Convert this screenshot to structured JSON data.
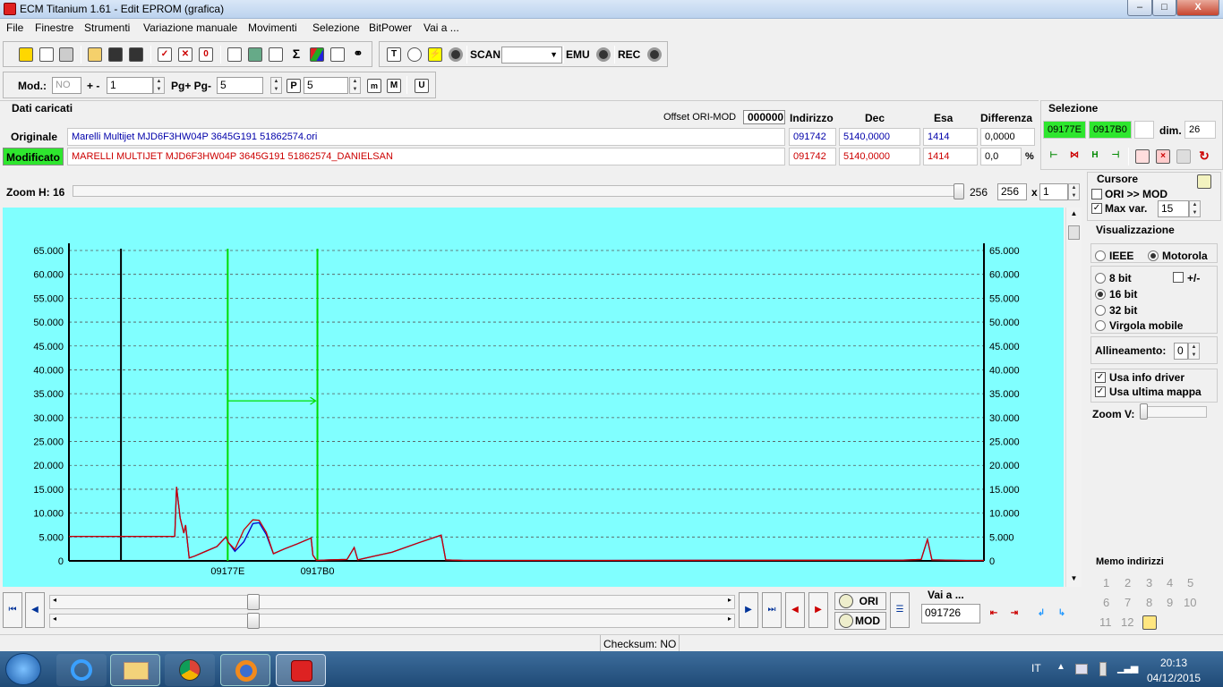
{
  "window": {
    "title": "ECM Titanium 1.61 - Edit EPROM (grafica)",
    "min": "–",
    "max": "□",
    "close": "X"
  },
  "menu": [
    "File",
    "Finestre",
    "Strumenti",
    "Variazione manuale",
    "Movimenti",
    "Selezione",
    "BitPower",
    "Vai a ..."
  ],
  "toolbar": {
    "scan": "SCAN",
    "emu": "EMU",
    "rec": "REC"
  },
  "toolbar2": {
    "mod_label": "Mod.:",
    "mod_value": "NO",
    "plusminus_label": "+ -",
    "plusminus_value": "1",
    "pg_label": "Pg+ Pg-",
    "pg_value": "5",
    "p_icon": "P",
    "p_value": "5",
    "m1": "m",
    "m2": "M",
    "u": "U"
  },
  "loaded": {
    "title": "Dati caricati",
    "offset_label": "Offset ORI-MOD",
    "offset_value": "000000",
    "col_indirizzo": "Indirizzo",
    "col_dec": "Dec",
    "col_esa": "Esa",
    "col_diff": "Differenza",
    "originale": {
      "label": "Originale",
      "file": "Marelli Multijet MJD6F3HW04P 3645G191 51862574.ori",
      "indirizzo": "091742",
      "dec": "5140,0000",
      "esa": "1414",
      "diff": "0,0000"
    },
    "modificato": {
      "label": "Modificato",
      "file": "MARELLI MULTIJET MJD6F3HW04P 3645G191 51862574_DANIELSAN",
      "indirizzo": "091742",
      "dec": "5140,0000",
      "esa": "1414",
      "diff": "0,0",
      "pct": "%"
    }
  },
  "selezione": {
    "title": "Selezione",
    "start": "09177E",
    "end": "0917B0",
    "dim_label": "dim.",
    "dim_value": "26"
  },
  "zoom": {
    "label": "Zoom H: 16",
    "value1": "256",
    "value2": "256",
    "x": "x",
    "value3": "1"
  },
  "cursore": {
    "title": "Cursore",
    "ori_mod": "ORI >> MOD",
    "max_var": "Max var.",
    "max_var_value": "15"
  },
  "visualizzazione": {
    "title": "Visualizzazione",
    "ieee": "IEEE",
    "motorola": "Motorola",
    "b8": "8 bit",
    "pm": "+/-",
    "b16": "16 bit",
    "b32": "32 bit",
    "virgola": "Virgola mobile",
    "allineamento": "Allineamento:",
    "allineamento_value": "0",
    "usa_info": "Usa info driver",
    "usa_ultima": "Usa ultima mappa",
    "zoom_v": "Zoom V:"
  },
  "memo": {
    "title": "Memo indirizzi",
    "numbers": [
      "1",
      "2",
      "3",
      "4",
      "5",
      "6",
      "7",
      "8",
      "9",
      "10",
      "11",
      "12"
    ]
  },
  "bottom": {
    "ori": "ORI",
    "mod": "MOD",
    "vai_label": "Vai a ...",
    "vai_value": "091726",
    "checksum": "Checksum: NO"
  },
  "taskbar": {
    "lang": "IT",
    "time": "20:13",
    "date": "04/12/2015"
  },
  "colors": {
    "plot_bg": "#80ffff",
    "original": "#0000cc",
    "modified": "#cc0000",
    "cursor": "#000000",
    "selection": "#00dd00"
  },
  "chart_data": {
    "type": "line",
    "yticks": [
      "0",
      "5.000",
      "10.000",
      "15.000",
      "20.000",
      "25.000",
      "30.000",
      "35.000",
      "40.000",
      "45.000",
      "50.000",
      "55.000",
      "60.000",
      "65.000"
    ],
    "ylim": [
      0,
      65000
    ],
    "x_labels": [
      "09177E",
      "0917B0"
    ],
    "grid": true,
    "xlim": [
      0,
      1020
    ],
    "cursor_x": 58,
    "selection_x": [
      177,
      277
    ],
    "series": [
      {
        "color": "#0000cc",
        "points": [
          [
            0,
            5140
          ],
          [
            118,
            5140
          ],
          [
            120,
            15500
          ],
          [
            124,
            9000
          ],
          [
            128,
            5800
          ],
          [
            130,
            7500
          ],
          [
            134,
            600
          ],
          [
            140,
            1000
          ],
          [
            150,
            1800
          ],
          [
            165,
            3000
          ],
          [
            175,
            5000
          ],
          [
            178,
            3800
          ],
          [
            185,
            2000
          ],
          [
            195,
            4000
          ],
          [
            205,
            7800
          ],
          [
            212,
            8000
          ],
          [
            220,
            5500
          ],
          [
            228,
            1500
          ],
          [
            240,
            2500
          ],
          [
            255,
            3600
          ],
          [
            270,
            4800
          ],
          [
            272,
            1200
          ],
          [
            276,
            100
          ],
          [
            290,
            200
          ],
          [
            310,
            300
          ],
          [
            318,
            2800
          ],
          [
            322,
            200
          ],
          [
            340,
            1000
          ],
          [
            360,
            1800
          ],
          [
            390,
            3800
          ],
          [
            415,
            5400
          ],
          [
            420,
            200
          ],
          [
            440,
            100
          ],
          [
            600,
            100
          ],
          [
            930,
            150
          ],
          [
            950,
            300
          ],
          [
            957,
            4500
          ],
          [
            962,
            200
          ],
          [
            1000,
            100
          ],
          [
            1020,
            100
          ]
        ]
      },
      {
        "color": "#cc0000",
        "points": [
          [
            0,
            5140
          ],
          [
            118,
            5140
          ],
          [
            120,
            15500
          ],
          [
            124,
            9000
          ],
          [
            128,
            5800
          ],
          [
            130,
            7500
          ],
          [
            134,
            600
          ],
          [
            140,
            1000
          ],
          [
            150,
            1800
          ],
          [
            165,
            3000
          ],
          [
            175,
            5000
          ],
          [
            178,
            3800
          ],
          [
            185,
            2400
          ],
          [
            195,
            6500
          ],
          [
            205,
            8600
          ],
          [
            212,
            8500
          ],
          [
            220,
            6000
          ],
          [
            228,
            1500
          ],
          [
            240,
            2500
          ],
          [
            255,
            3600
          ],
          [
            270,
            4800
          ],
          [
            272,
            1200
          ],
          [
            276,
            100
          ],
          [
            290,
            200
          ],
          [
            310,
            300
          ],
          [
            318,
            2800
          ],
          [
            322,
            200
          ],
          [
            340,
            1000
          ],
          [
            360,
            1800
          ],
          [
            390,
            3800
          ],
          [
            415,
            5400
          ],
          [
            420,
            200
          ],
          [
            440,
            100
          ],
          [
            600,
            100
          ],
          [
            930,
            150
          ],
          [
            950,
            300
          ],
          [
            957,
            4500
          ],
          [
            962,
            200
          ],
          [
            1000,
            100
          ],
          [
            1020,
            100
          ]
        ]
      }
    ]
  }
}
